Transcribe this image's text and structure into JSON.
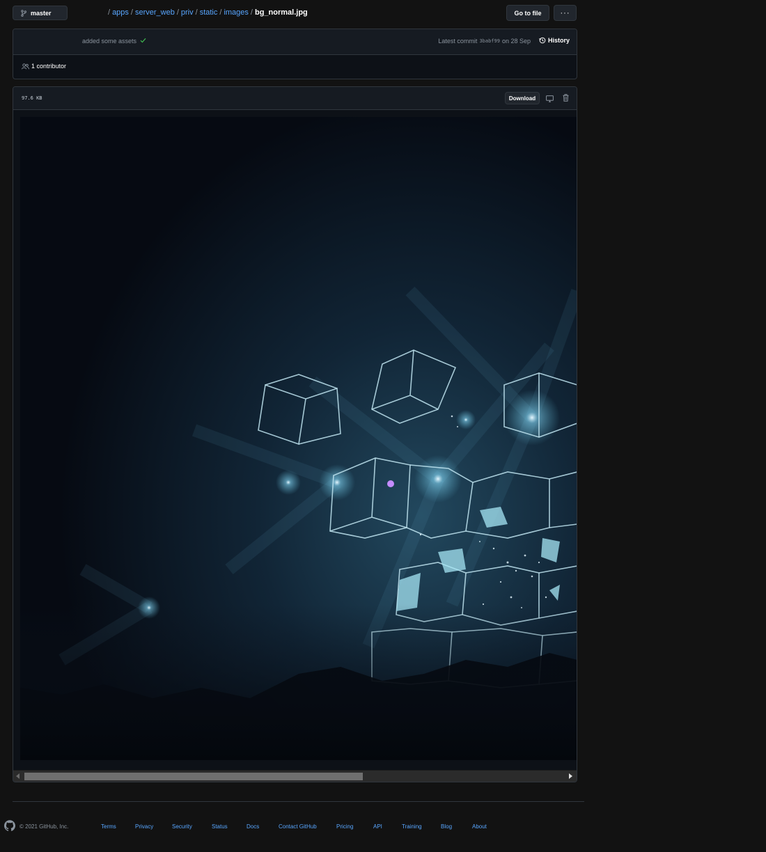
{
  "branch": {
    "label": "master",
    "icon": "git-branch-icon"
  },
  "breadcrumb": {
    "items": [
      "apps",
      "server_web",
      "priv",
      "static",
      "images"
    ],
    "separator": "/",
    "file": "bg_normal.jpg"
  },
  "actions": {
    "go_to_file": "Go to file",
    "more": "···"
  },
  "commit": {
    "message": "added some assets",
    "status": "success",
    "latest_label": "Latest commit",
    "sha": "3babf99",
    "date": "on 28 Sep",
    "history_label": "History"
  },
  "contributors": {
    "label": "1 contributor"
  },
  "file": {
    "size": "97.6 KB",
    "download_label": "Download"
  },
  "colors": {
    "background": "#121212",
    "link": "#58a6ff",
    "success": "#3fb950",
    "border": "#30363d",
    "image_glow": "#5fb8d4"
  },
  "footer": {
    "copyright": "© 2021 GitHub, Inc.",
    "links": [
      "Terms",
      "Privacy",
      "Security",
      "Status",
      "Docs",
      "Contact GitHub",
      "Pricing",
      "API",
      "Training",
      "Blog",
      "About"
    ]
  }
}
